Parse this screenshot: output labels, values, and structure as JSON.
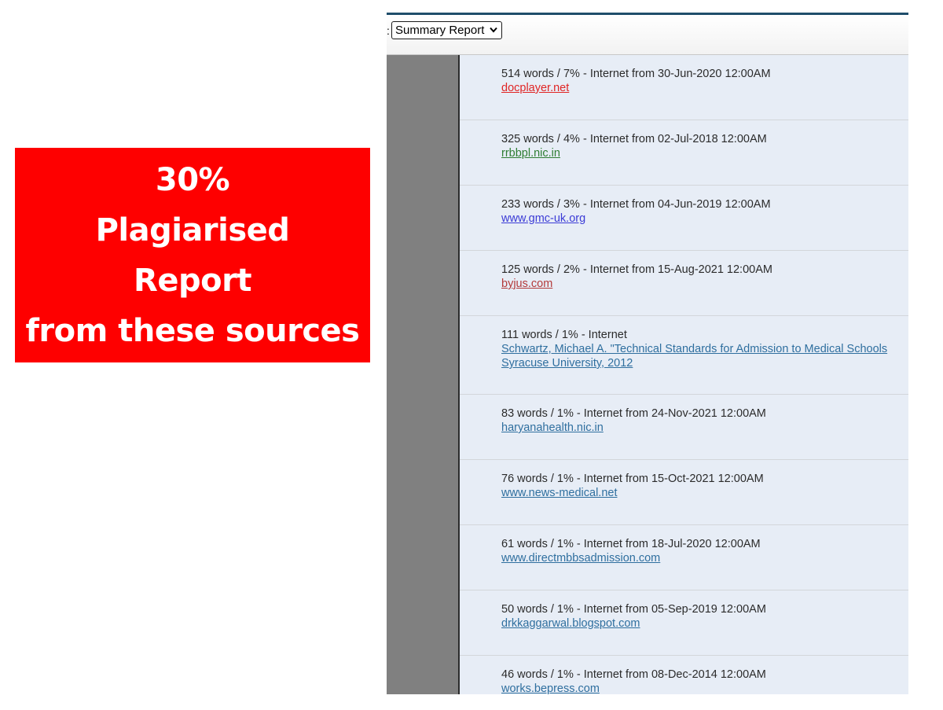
{
  "callout": {
    "line1": "30%",
    "line2": "Plagiarised",
    "line3": "Report",
    "line4": "from these sources"
  },
  "toolbar": {
    "colon": ":",
    "report_select_value": "Summary Report"
  },
  "colors": {
    "callout_bg": "#fe0000",
    "accent_line": "#1f4e6b",
    "sidebar": "#808080",
    "list_bg": "#e7edf6"
  },
  "sources": [
    {
      "meta": "514 words / 7% - Internet from 30-Jun-2020 12:00AM",
      "lines": [
        "docplayer.net"
      ],
      "color": "#e02525"
    },
    {
      "meta": "325 words / 4% - Internet from 02-Jul-2018 12:00AM",
      "lines": [
        "rrbbpl.nic.in"
      ],
      "color": "#2e7d32"
    },
    {
      "meta": "233 words / 3% - Internet from 04-Jun-2019 12:00AM",
      "lines": [
        "www.gmc-uk.org"
      ],
      "color": "#3b3bd6"
    },
    {
      "meta": "125 words / 2% - Internet from 15-Aug-2021 12:00AM",
      "lines": [
        "byjus.com"
      ],
      "color": "#b33a3a"
    },
    {
      "meta": "111 words / 1% - Internet",
      "lines": [
        "Schwartz, Michael A. \"Technical Standards for Admission to Medical Schools",
        "Syracuse University, 2012"
      ],
      "color": "#2f6f9f"
    },
    {
      "meta": "83 words / 1% - Internet from 24-Nov-2021 12:00AM",
      "lines": [
        "haryanahealth.nic.in"
      ],
      "color": "#2f6f9f"
    },
    {
      "meta": "76 words / 1% - Internet from 15-Oct-2021 12:00AM",
      "lines": [
        "www.news-medical.net"
      ],
      "color": "#2f6f9f"
    },
    {
      "meta": "61 words / 1% - Internet from 18-Jul-2020 12:00AM",
      "lines": [
        "www.directmbbsadmission.com"
      ],
      "color": "#2f6f9f"
    },
    {
      "meta": "50 words / 1% - Internet from 05-Sep-2019 12:00AM",
      "lines": [
        "drkkaggarwal.blogspot.com"
      ],
      "color": "#2f6f9f"
    },
    {
      "meta": "46 words / 1% - Internet from 08-Dec-2014 12:00AM",
      "lines": [
        "works.bepress.com"
      ],
      "color": "#2f6f9f"
    }
  ]
}
